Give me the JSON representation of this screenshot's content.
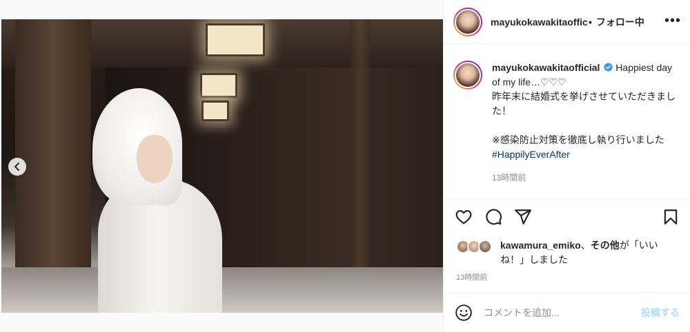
{
  "post": {
    "username": "mayukokawakitaofficial",
    "header_username": "mayukokawakitaoffic",
    "separator": "•",
    "follow_label": "フォロー中",
    "more_label": "•••",
    "caption_line1": "Happiest day of my life…♡♡♡",
    "caption_line2": "昨年末に結婚式を挙げさせていただきました！",
    "caption_line3": "※感染防止対策を徹底し執り行いました",
    "hashtag": "#HappilyEverAfter",
    "caption_time": "13時間前",
    "likes_user": "kawamura_emiko",
    "likes_sep": "、",
    "likes_others": "その他",
    "likes_suffix": "が「いいね！」しました",
    "post_time": "13時間前",
    "comment_placeholder": "コメントを追加...",
    "post_button": "投稿する",
    "carousel": {
      "count": 3,
      "active_index": 2
    }
  },
  "icons": {
    "verified": "verified-badge-icon",
    "like": "heart-icon",
    "comment": "comment-icon",
    "share": "paper-plane-icon",
    "save": "bookmark-icon",
    "emoji": "smiley-icon",
    "prev": "chevron-left-icon"
  },
  "colors": {
    "verified": "#3897f0",
    "hashtag": "#00376b",
    "muted": "#8e8e8e",
    "post_button": "#b2dffc",
    "text": "#262626"
  }
}
